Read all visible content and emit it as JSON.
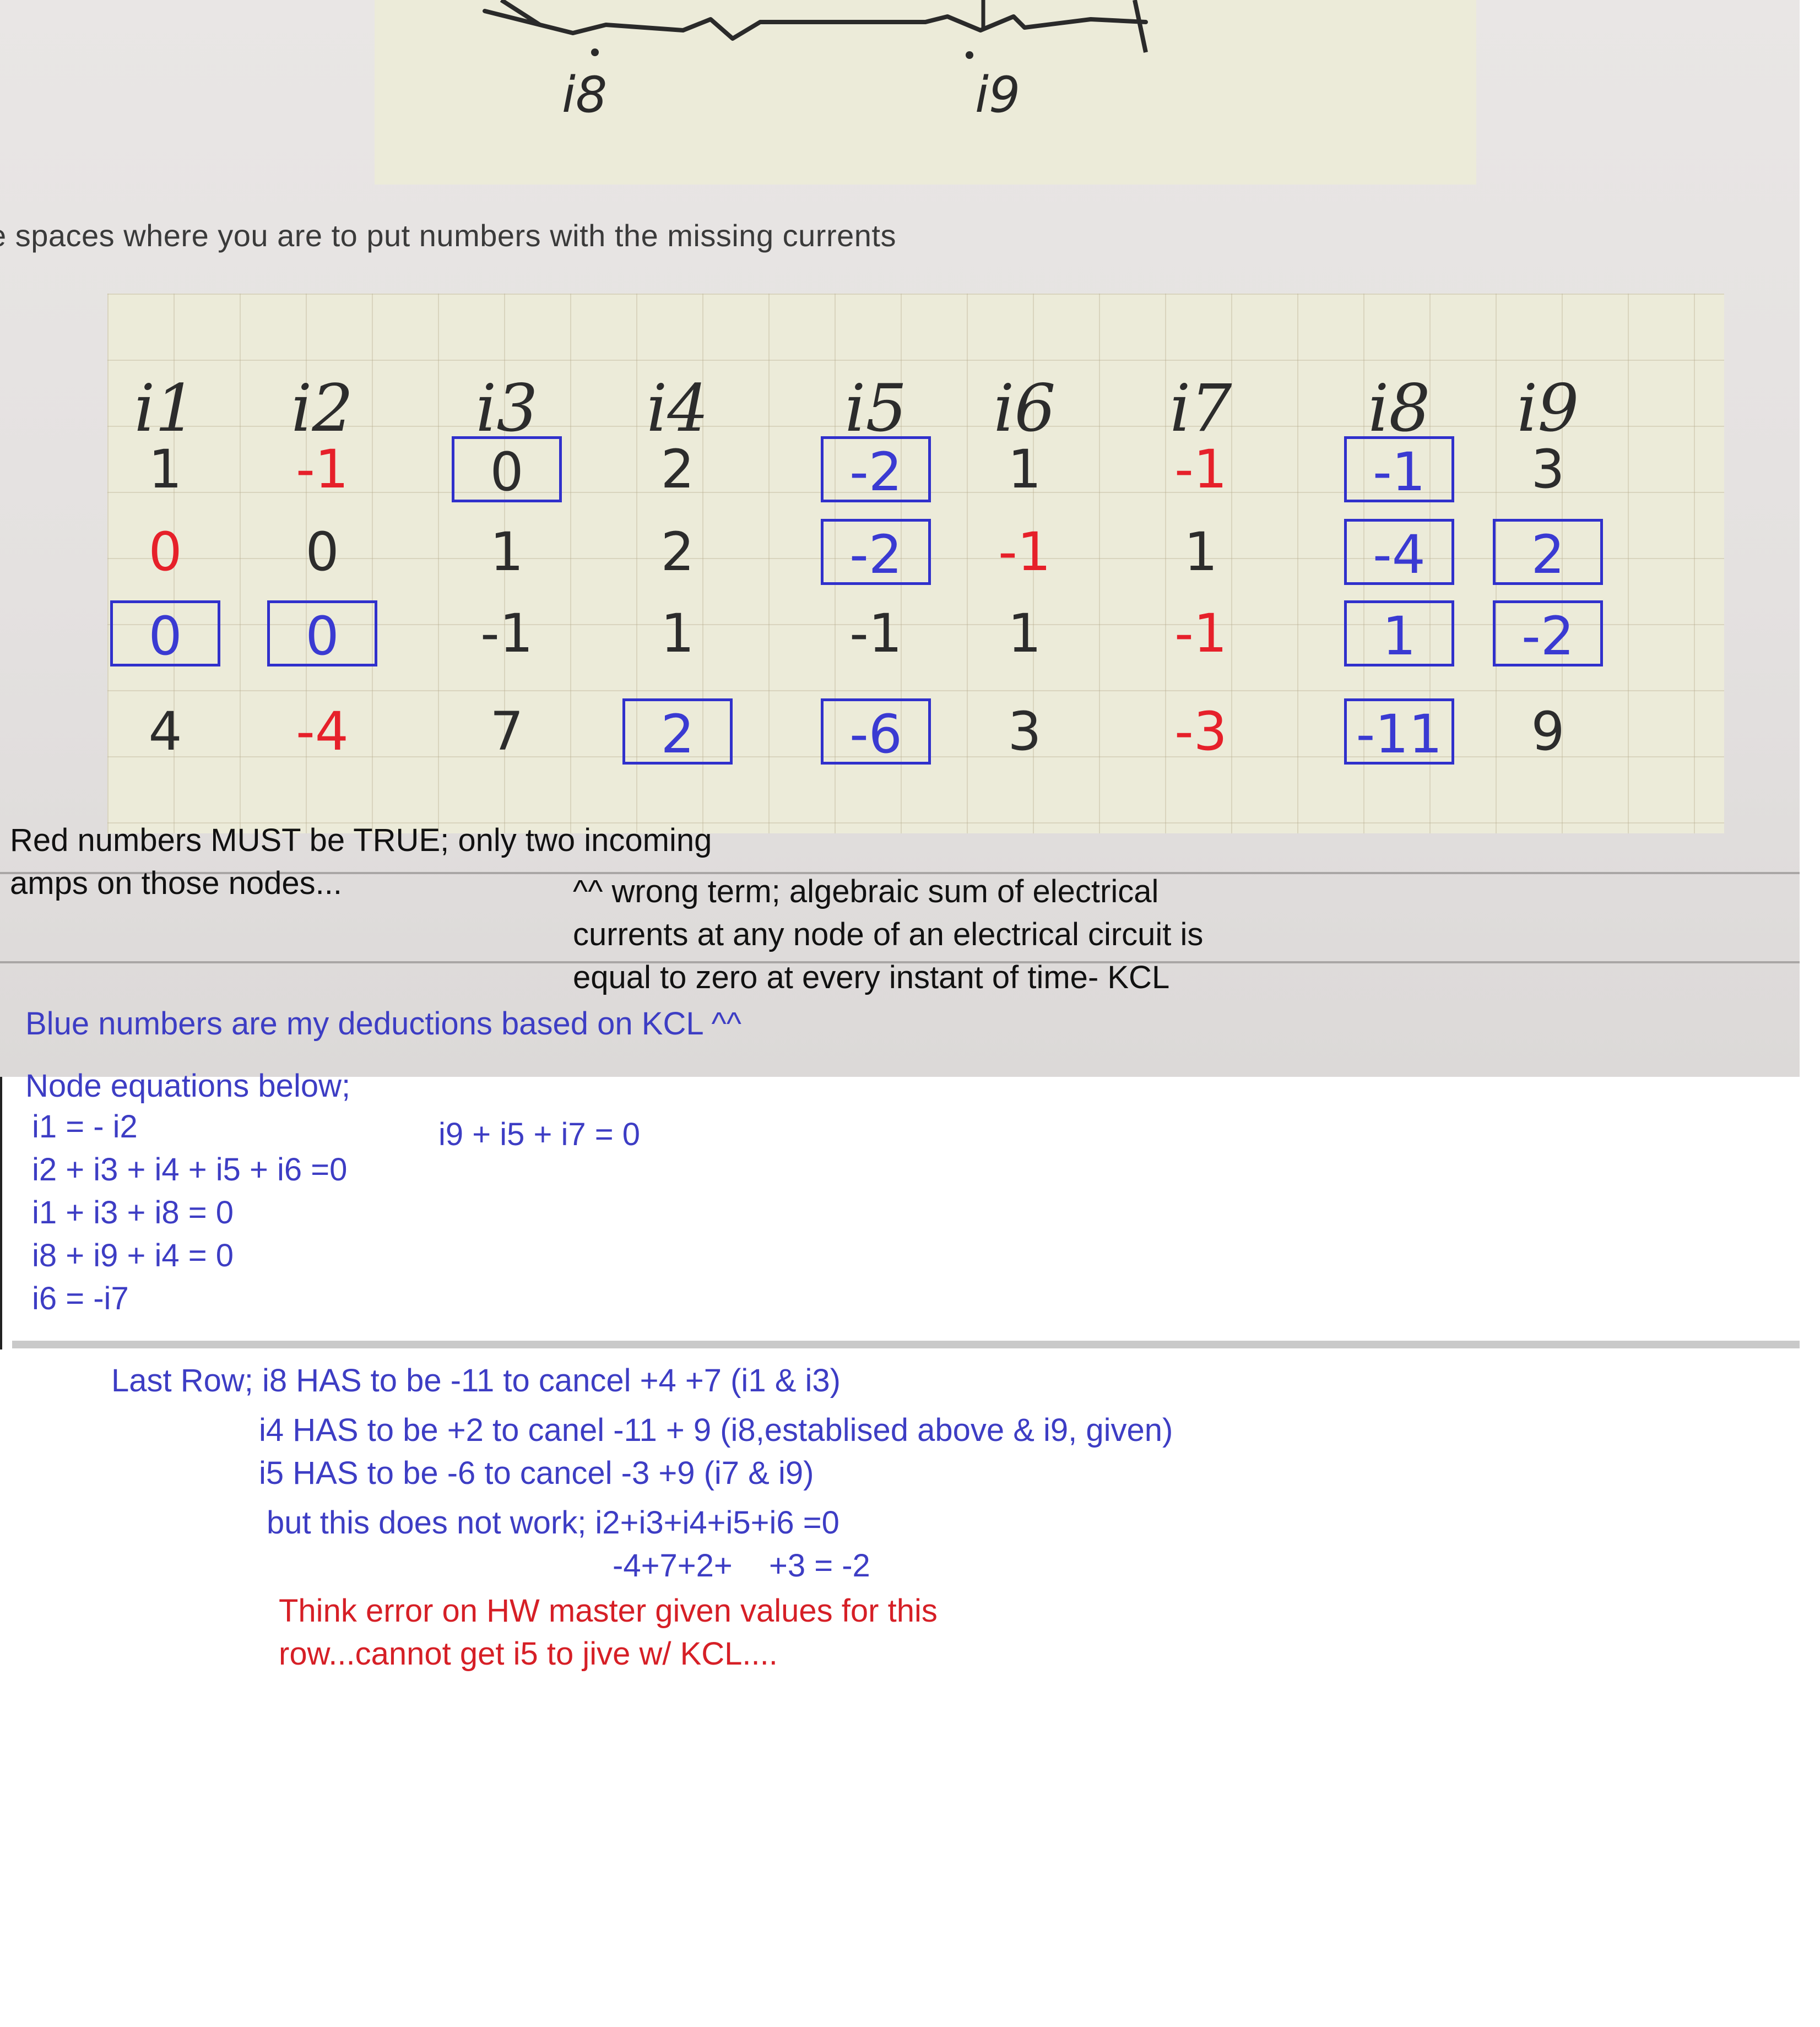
{
  "circuit": {
    "label_i8": "i8",
    "label_i9": "i9"
  },
  "instruction": "e spaces where you are to put numbers with the missing currents",
  "table": {
    "headers": [
      "i1",
      "i2",
      "i3",
      "i4",
      "i5",
      "i6",
      "i7",
      "i8",
      "i9"
    ],
    "rows": [
      [
        {
          "text": "1",
          "style": "ink"
        },
        {
          "text": "-1",
          "style": "red"
        },
        {
          "text": "0",
          "style": "ink-boxed"
        },
        {
          "text": "2",
          "style": "ink"
        },
        {
          "text": "-2",
          "style": "blue-boxed"
        },
        {
          "text": "1",
          "style": "ink"
        },
        {
          "text": "-1",
          "style": "red"
        },
        {
          "text": "-1",
          "style": "blue-boxed"
        },
        {
          "text": "3",
          "style": "ink"
        }
      ],
      [
        {
          "text": "0",
          "style": "red"
        },
        {
          "text": "0",
          "style": "ink"
        },
        {
          "text": "1",
          "style": "ink"
        },
        {
          "text": "2",
          "style": "ink"
        },
        {
          "text": "-2",
          "style": "blue-boxed"
        },
        {
          "text": "-1",
          "style": "red"
        },
        {
          "text": "1",
          "style": "ink"
        },
        {
          "text": "-4",
          "style": "blue-boxed"
        },
        {
          "text": "2",
          "style": "blue-boxed"
        }
      ],
      [
        {
          "text": "0",
          "style": "blue-boxed"
        },
        {
          "text": "0",
          "style": "blue-boxed"
        },
        {
          "text": "-1",
          "style": "ink"
        },
        {
          "text": "1",
          "style": "ink"
        },
        {
          "text": "-1",
          "style": "ink"
        },
        {
          "text": "1",
          "style": "ink"
        },
        {
          "text": "-1",
          "style": "red"
        },
        {
          "text": "1",
          "style": "blue-boxed"
        },
        {
          "text": "-2",
          "style": "blue-boxed"
        }
      ],
      [
        {
          "text": "4",
          "style": "ink"
        },
        {
          "text": "-4",
          "style": "red"
        },
        {
          "text": "7",
          "style": "ink"
        },
        {
          "text": "2",
          "style": "blue-boxed"
        },
        {
          "text": "-6",
          "style": "blue-boxed"
        },
        {
          "text": "3",
          "style": "ink"
        },
        {
          "text": "-3",
          "style": "red"
        },
        {
          "text": "-11",
          "style": "blue-boxed"
        },
        {
          "text": "9",
          "style": "ink"
        }
      ]
    ]
  },
  "notes": {
    "red_rule_1": "Red numbers MUST be TRUE; only two incoming",
    "red_rule_2": "amps on those nodes...",
    "kcl_1": "^^ wrong term; algebraic sum of electrical",
    "kcl_2": "currents at any node of an electrical circuit is",
    "kcl_3": "equal to zero at every instant of time- KCL",
    "blue_note": "Blue numbers are my deductions based on KCL ^^"
  },
  "equations": {
    "heading": "Node equations below;",
    "eq1": "i1 = - i2",
    "eq2": "i2 + i3 + i4 + i5 + i6 =0",
    "eq3": "i1 + i3 + i8 = 0",
    "eq4": "i8 + i9 + i4 = 0",
    "eq5": "i6 = -i7",
    "eq6": "i9 + i5 + i7 = 0"
  },
  "analysis": {
    "line1": "Last Row; i8 HAS to be -11  to cancel +4 +7 (i1 & i3)",
    "line2": "i4 HAS to be +2 to canel -11 + 9 (i8,establised above & i9, given)",
    "line3": "i5 HAS to be -6 to cancel -3 +9 (i7 & i9)",
    "line4": "but this does not work; i2+i3+i4+i5+i6 =0",
    "line5a": "-4+7+2+",
    "line5b": "+3 = -2",
    "conclusion1": "Think error on HW master given values for this",
    "conclusion2": "row...cannot get i5 to jive w/ KCL...."
  },
  "colors": {
    "blue_ink": "#3d3dc4",
    "red_ink": "#d61f26",
    "box_blue": "#3030cc",
    "paper": "#ecebd9"
  }
}
